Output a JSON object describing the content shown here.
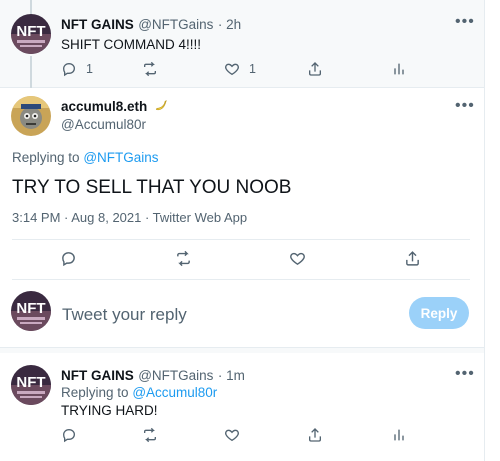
{
  "tweet_context": {
    "display_name": "NFT GAINS",
    "handle": "@NFTGains",
    "time": "· 2h",
    "text": "SHIFT COMMAND 4!!!!",
    "reply_count": "1",
    "like_count": "1",
    "avatar_text": "NFT"
  },
  "main_tweet": {
    "display_name": "accumul8.eth",
    "handle": "@Accumul80r",
    "replying_to_label": "Replying to",
    "replying_to_handle": "@NFTGains",
    "text": "TRY TO SELL THAT YOU NOOB",
    "timestamp": "3:14 PM · Aug 8, 2021 · Twitter Web App"
  },
  "composer": {
    "placeholder": "Tweet your reply",
    "reply_label": "Reply",
    "avatar_text": "NFT"
  },
  "reply_tweet": {
    "display_name": "NFT GAINS",
    "handle": "@NFTGains",
    "time": "· 1m",
    "replying_to_label": "Replying to",
    "replying_to_handle": "@Accumul80r",
    "text": "TRYING HARD!",
    "avatar_text": "NFT"
  },
  "colors": {
    "accent": "#1d9bf0",
    "reply_button_disabled": "#9bd1f9",
    "muted_text": "#536471",
    "context_bg": "#f7f9fa"
  }
}
